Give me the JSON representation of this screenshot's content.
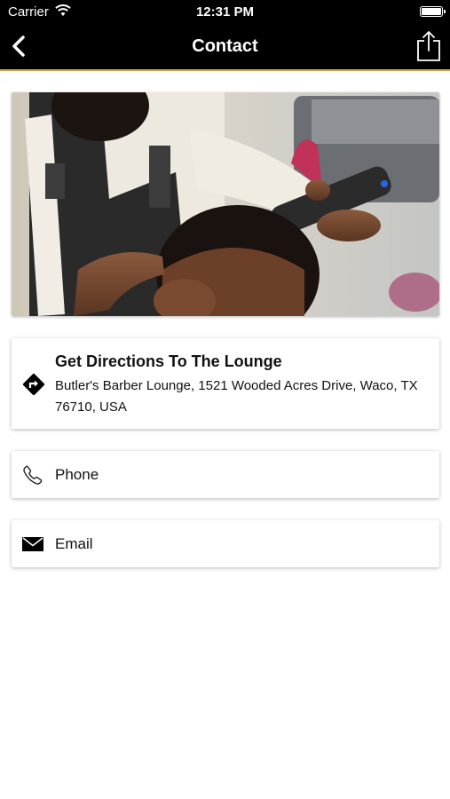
{
  "status_bar": {
    "carrier": "Carrier",
    "time": "12:31 PM"
  },
  "nav": {
    "title": "Contact"
  },
  "directions": {
    "heading": "Get Directions To The Lounge",
    "address": "Butler's Barber Lounge, 1521 Wooded Acres Drive, Waco, TX 76710, USA"
  },
  "phone": {
    "label": "Phone"
  },
  "email": {
    "label": "Email"
  },
  "colors": {
    "nav_background": "#000000",
    "nav_accent": "#c8a94a",
    "text": "#111111"
  },
  "icons": [
    "back-icon",
    "share-icon",
    "wifi-icon",
    "battery-icon",
    "directions-icon",
    "phone-icon",
    "email-icon"
  ]
}
